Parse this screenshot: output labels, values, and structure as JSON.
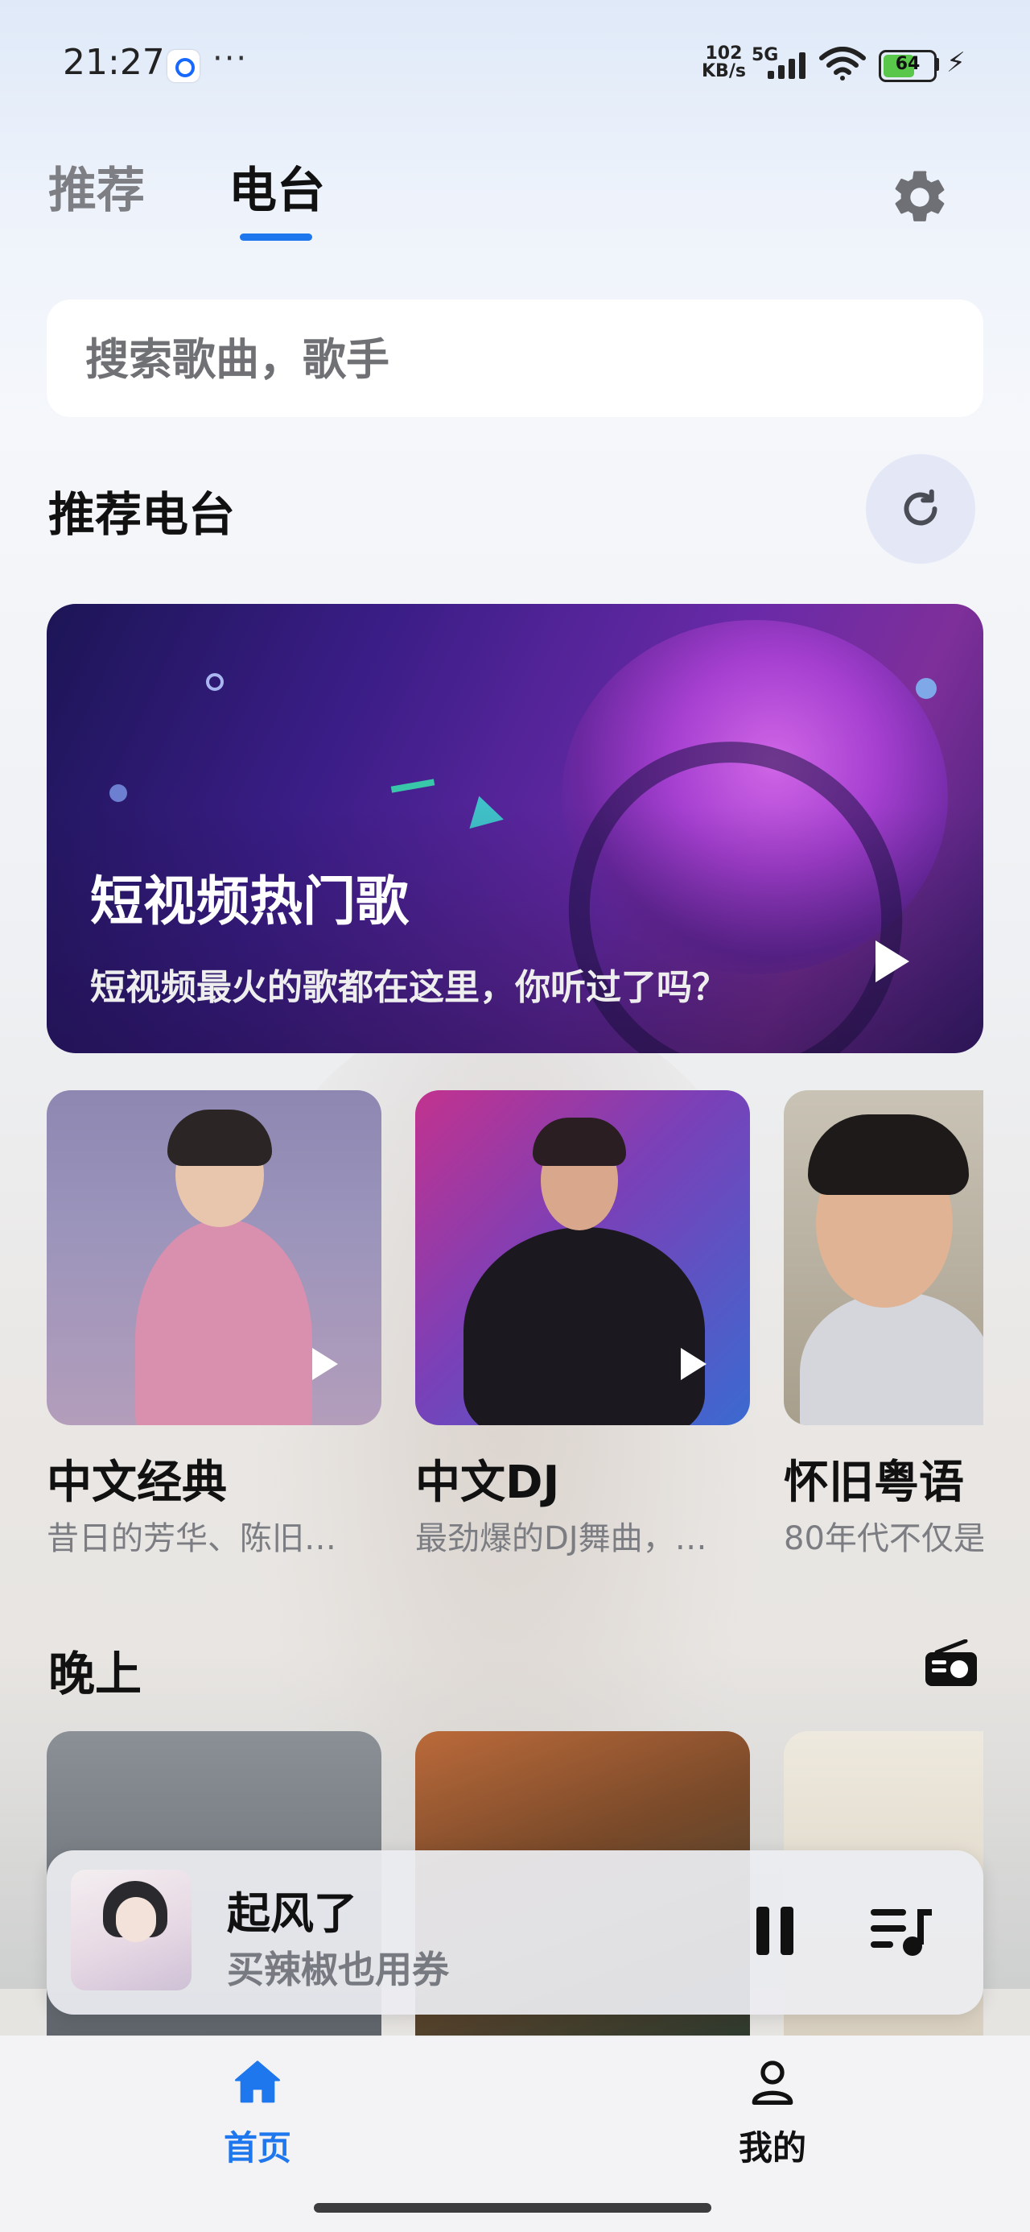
{
  "status_bar": {
    "time": "21:27",
    "dots": "···",
    "net_speed_value": "102",
    "net_speed_unit": "KB/s",
    "network": "5G",
    "battery": "64"
  },
  "tabs": [
    {
      "label": "推荐",
      "active": false
    },
    {
      "label": "电台",
      "active": true
    }
  ],
  "search": {
    "placeholder": "搜索歌曲，歌手"
  },
  "recommend": {
    "title": "推荐电台",
    "hero": {
      "title": "短视频热门歌",
      "subtitle": "短视频最火的歌都在这里，你听过了吗？"
    },
    "cards": [
      {
        "title": "中文经典",
        "subtitle": "昔日的芳华、陈旧…"
      },
      {
        "title": "中文DJ",
        "subtitle": "最劲爆的DJ舞曲，…"
      },
      {
        "title": "怀旧粤语",
        "subtitle": "80年代不仅是"
      }
    ]
  },
  "evening": {
    "title": "晚上"
  },
  "player": {
    "title": "起风了",
    "artist": "买辣椒也用券"
  },
  "nav": [
    {
      "label": "首页",
      "icon": "home-icon",
      "active": true
    },
    {
      "label": "我的",
      "icon": "user-icon",
      "active": false
    }
  ],
  "colors": {
    "accent": "#1f77ee",
    "text": "#111111",
    "muted": "#7b7d82"
  }
}
